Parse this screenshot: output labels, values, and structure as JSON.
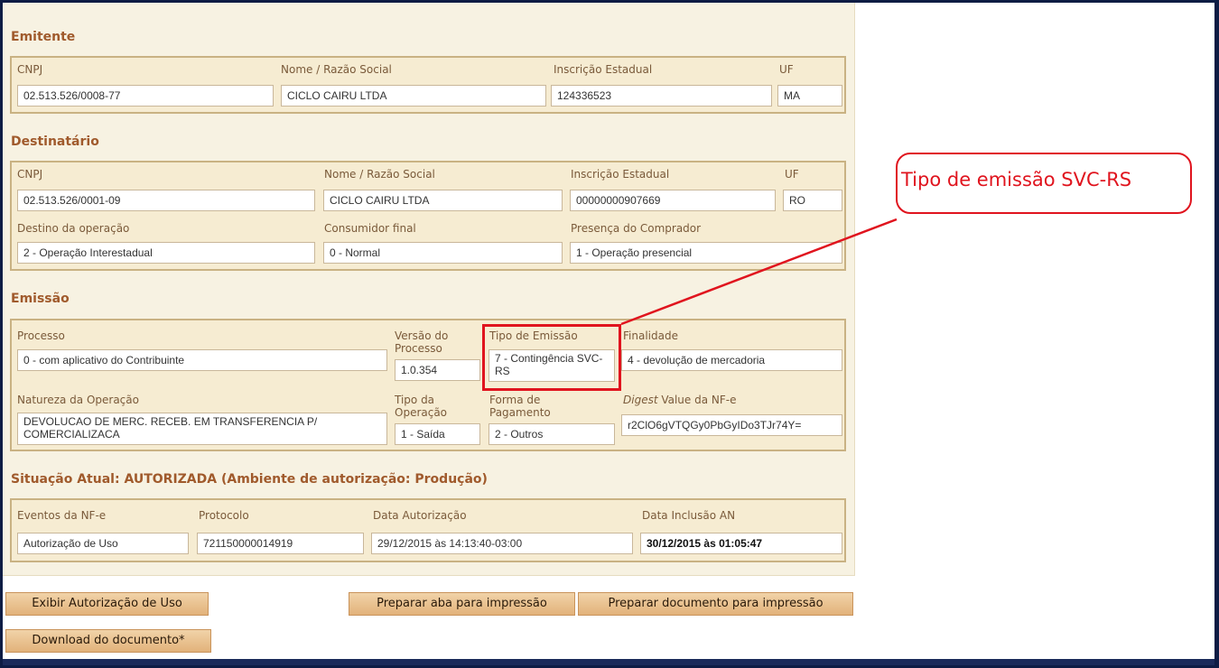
{
  "emitente": {
    "title": "Emitente",
    "labels": {
      "cnpj": "CNPJ",
      "nome": "Nome / Razão Social",
      "ie": "Inscrição Estadual",
      "uf": "UF"
    },
    "values": {
      "cnpj": "02.513.526/0008-77",
      "nome": "CICLO CAIRU LTDA",
      "ie": "124336523",
      "uf": "MA"
    }
  },
  "destinatario": {
    "title": "Destinatário",
    "labels": {
      "cnpj": "CNPJ",
      "nome": "Nome / Razão Social",
      "ie": "Inscrição Estadual",
      "uf": "UF",
      "destino": "Destino da operação",
      "consumidor": "Consumidor final",
      "presenca": "Presença do Comprador"
    },
    "values": {
      "cnpj": "02.513.526/0001-09",
      "nome": "CICLO CAIRU LTDA",
      "ie": "00000000907669",
      "uf": "RO",
      "destino": "2 - Operação Interestadual",
      "consumidor": "0 - Normal",
      "presenca": "1 - Operação presencial"
    }
  },
  "emissao": {
    "title": "Emissão",
    "labels": {
      "processo": "Processo",
      "versao": "Versão do Processo",
      "tipo_emissao": "Tipo de Emissão",
      "finalidade": "Finalidade",
      "natureza": "Natureza da Operação",
      "tipo_operacao": "Tipo da Operação",
      "forma_pagamento": "Forma de Pagamento",
      "digest_em": "Digest",
      "digest_rest": " Value da NF-e"
    },
    "values": {
      "processo": "0 - com aplicativo do Contribuinte",
      "versao": "1.0.354",
      "tipo_emissao": "7 - Contingência SVC-RS",
      "finalidade": "4 - devolução de mercadoria",
      "natureza": "DEVOLUCAO DE MERC. RECEB. EM TRANSFERENCIA P/ COMERCIALIZACA",
      "tipo_operacao": "1 - Saída",
      "forma_pagamento": "2 - Outros",
      "digest": "r2ClO6gVTQGy0PbGyIDo3TJr74Y="
    }
  },
  "situacao": {
    "title": "Situação Atual: AUTORIZADA (Ambiente de autorização: Produção)",
    "labels": {
      "eventos": "Eventos da NF-e",
      "protocolo": "Protocolo",
      "data_aut": "Data Autorização",
      "data_incl": "Data Inclusão AN"
    },
    "values": {
      "eventos": "Autorização de Uso",
      "protocolo": "721150000014919",
      "data_aut": "29/12/2015 às 14:13:40-03:00",
      "data_incl": "30/12/2015 às 01:05:47"
    }
  },
  "buttons": {
    "exibir": "Exibir Autorização de Uso",
    "aba": "Preparar aba para impressão",
    "documento": "Preparar documento para impressão",
    "download": "Download do documento*"
  },
  "annotation": {
    "text": "Tipo de emissão SVC-RS",
    "color": "#e0141e"
  },
  "colors": {
    "section_title": "#a05a2c",
    "panel_bg": "#f7f2e2",
    "box_border": "#c9b283",
    "button": "#e2b27a"
  }
}
